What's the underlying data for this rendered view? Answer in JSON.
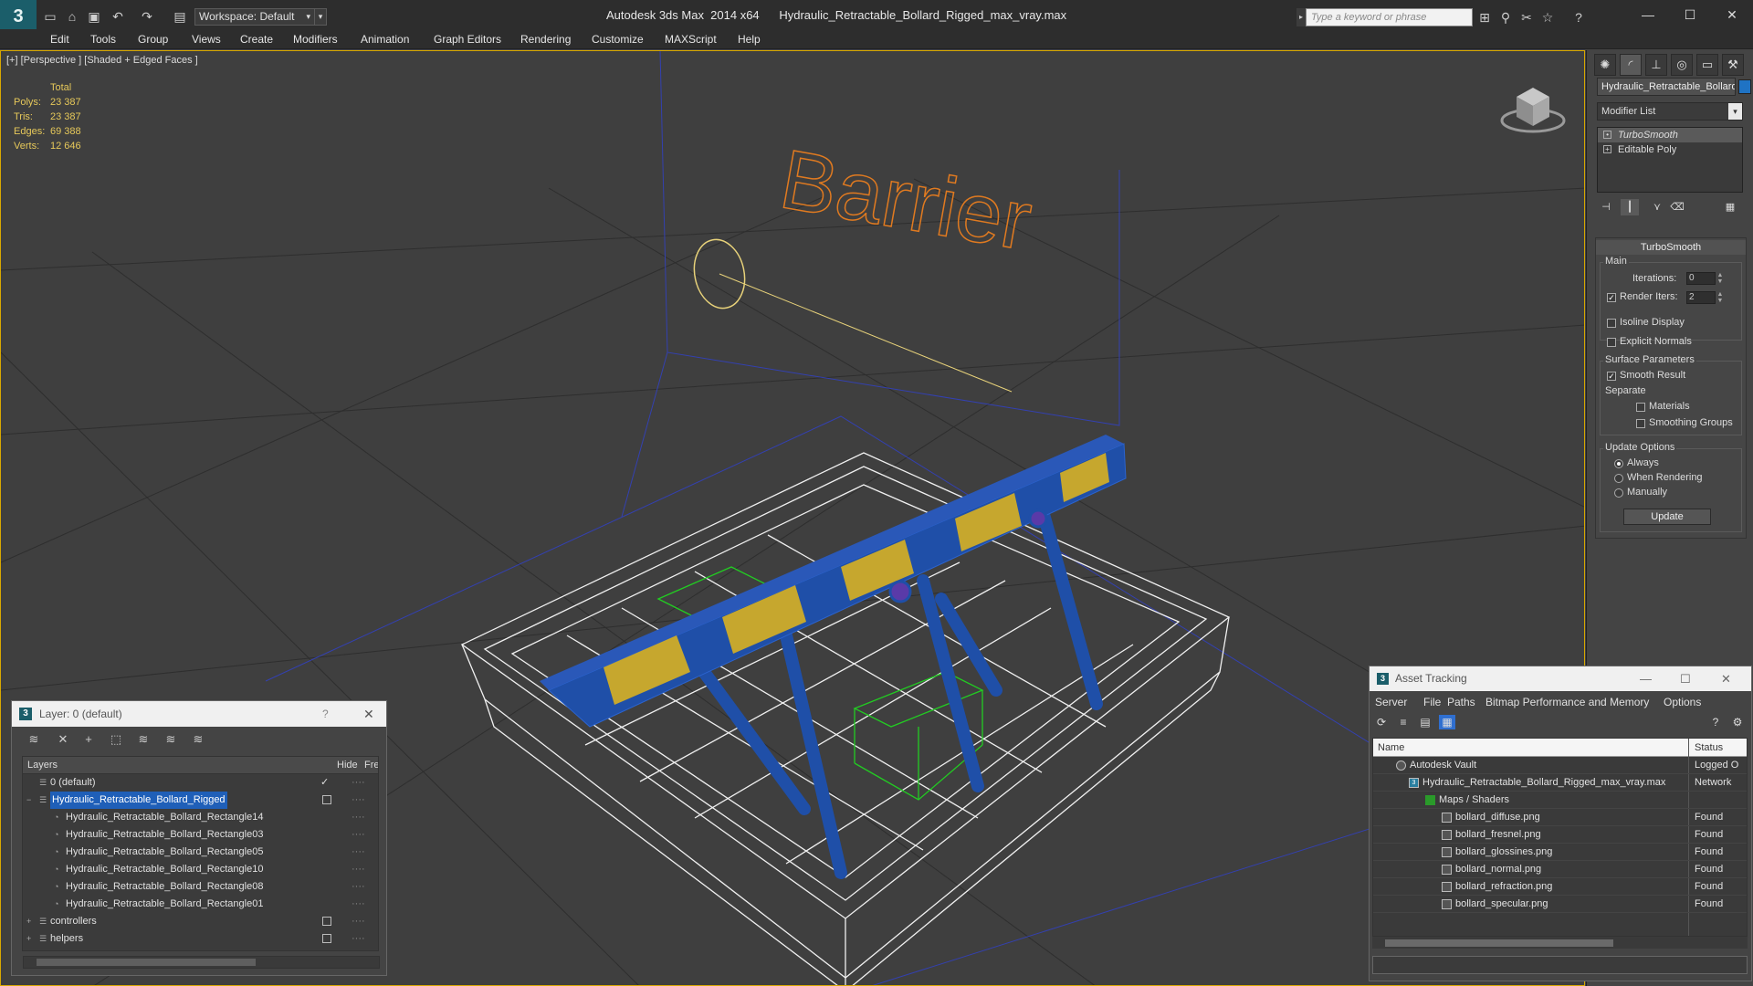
{
  "titlebar": {
    "logo": "3",
    "workspace": "Workspace: Default",
    "app_title": "Autodesk 3ds Max  2014 x64      Hydraulic_Retractable_Bollard_Rigged_max_vray.max",
    "search_placeholder": "Type a keyword or phrase",
    "window_buttons": [
      "—",
      "☐",
      "✕"
    ]
  },
  "menu": {
    "items": [
      "Edit",
      "Tools",
      "Group",
      "Views",
      "Create",
      "Modifiers",
      "Animation",
      "Graph Editors",
      "Rendering",
      "Customize",
      "MAXScript",
      "Help"
    ]
  },
  "viewport": {
    "label": "[+] [Perspective ] [Shaded + Edged Faces ]",
    "stats": {
      "header": "Total",
      "rows": [
        {
          "label": "Polys:",
          "value": "23 387"
        },
        {
          "label": "Tris:",
          "value": "23 387"
        },
        {
          "label": "Edges:",
          "value": "69 388"
        },
        {
          "label": "Verts:",
          "value": "12 646"
        }
      ]
    },
    "scene_text": "Barrier",
    "colors": {
      "accent_border": "#d8a800",
      "wire": "#ffffff",
      "bollard_blue": "#1f4fa8",
      "bollard_yellow": "#d8b020",
      "helper_green": "#22cc22"
    }
  },
  "command_panel": {
    "object_name": "Hydraulic_Retractable_Bollard",
    "object_color": "#1f73c4",
    "modifier_list": "Modifier List",
    "stack": [
      {
        "label": "TurboSmooth",
        "selected": true
      },
      {
        "label": "Editable Poly",
        "selected": false
      }
    ],
    "rollout": {
      "title": "TurboSmooth",
      "main_label": "Main",
      "iterations_label": "Iterations:",
      "iterations_value": "0",
      "render_iters_label": "Render Iters:",
      "render_iters_value": "2",
      "isoline_label": "Isoline Display",
      "explicit_normals_label": "Explicit Normals",
      "surface_params_label": "Surface Parameters",
      "smooth_result_label": "Smooth Result",
      "separate_label": "Separate",
      "materials_label": "Materials",
      "smoothing_groups_label": "Smoothing Groups",
      "update_options_label": "Update Options",
      "always_label": "Always",
      "when_rendering_label": "When Rendering",
      "manually_label": "Manually",
      "update_button": "Update"
    }
  },
  "layer_panel": {
    "title": "Layer: 0 (default)",
    "help": "?",
    "close": "✕",
    "columns": {
      "layers": "Layers",
      "hide": "Hide",
      "freeze": "Free"
    },
    "rows": [
      {
        "name": "0 (default)",
        "indent": 0,
        "check": "✓"
      },
      {
        "name": "Hydraulic_Retractable_Bollard_Rigged",
        "indent": 0,
        "selected": true
      },
      {
        "name": "Hydraulic_Retractable_Bollard_Rectangle14",
        "indent": 1
      },
      {
        "name": "Hydraulic_Retractable_Bollard_Rectangle03",
        "indent": 1
      },
      {
        "name": "Hydraulic_Retractable_Bollard_Rectangle05",
        "indent": 1
      },
      {
        "name": "Hydraulic_Retractable_Bollard_Rectangle10",
        "indent": 1
      },
      {
        "name": "Hydraulic_Retractable_Bollard_Rectangle08",
        "indent": 1
      },
      {
        "name": "Hydraulic_Retractable_Bollard_Rectangle01",
        "indent": 1
      },
      {
        "name": "controllers",
        "indent": 0
      },
      {
        "name": "helpers",
        "indent": 0
      }
    ]
  },
  "asset_panel": {
    "title": "Asset Tracking",
    "menu": [
      "Server",
      "File",
      "Paths",
      "Bitmap Performance and Memory",
      "Options"
    ],
    "columns": {
      "name": "Name",
      "status": "Status"
    },
    "rows": [
      {
        "name": "Autodesk Vault",
        "indent": 1,
        "status": "Logged O"
      },
      {
        "name": "Hydraulic_Retractable_Bollard_Rigged_max_vray.max",
        "indent": 2,
        "status": "Network"
      },
      {
        "name": "Maps / Shaders",
        "indent": 3,
        "status": ""
      },
      {
        "name": "bollard_diffuse.png",
        "indent": 4,
        "status": "Found"
      },
      {
        "name": "bollard_fresnel.png",
        "indent": 4,
        "status": "Found"
      },
      {
        "name": "bollard_glossines.png",
        "indent": 4,
        "status": "Found"
      },
      {
        "name": "bollard_normal.png",
        "indent": 4,
        "status": "Found"
      },
      {
        "name": "bollard_refraction.png",
        "indent": 4,
        "status": "Found"
      },
      {
        "name": "bollard_specular.png",
        "indent": 4,
        "status": "Found"
      }
    ]
  }
}
